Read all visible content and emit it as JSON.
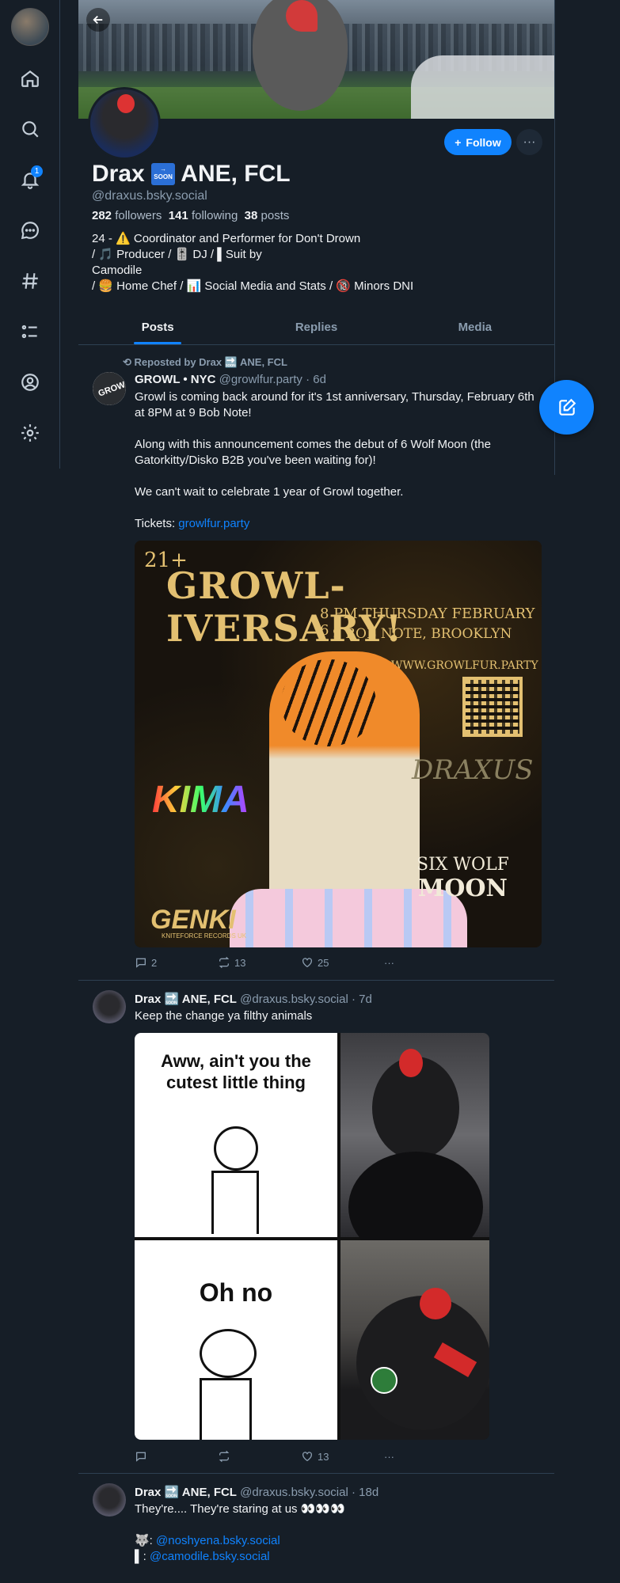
{
  "profile": {
    "display_name": "Drax",
    "name_suffix": "ANE, FCL",
    "soon_tag": "SOON",
    "handle": "@draxus.bsky.social",
    "follow_label": "Follow",
    "followers_count": "282",
    "followers_label": "followers",
    "following_count": "141",
    "following_label": "following",
    "posts_count": "38",
    "posts_label": "posts",
    "bio_line1": "24 - ⚠️ Coordinator and Performer for Don't Drown",
    "bio_line2": " / 🎵 Producer / 🎚️ DJ / ▌Suit by",
    "bio_line3": "Camodile",
    "bio_line4": " / 🍔 Home Chef / 📊 Social Media and Stats / 🔞 Minors DNI"
  },
  "nav": {
    "notification_badge": "1",
    "icons": [
      "home-icon",
      "search-icon",
      "bell-icon",
      "chat-icon",
      "hashtag-icon",
      "list-icon",
      "profile-icon",
      "gear-icon"
    ]
  },
  "tabs": [
    {
      "label": "Posts",
      "active": true
    },
    {
      "label": "Replies",
      "active": false
    },
    {
      "label": "Media",
      "active": false
    }
  ],
  "posts": [
    {
      "repost_label": "Reposted by Drax 🔜 ANE, FCL",
      "author": "GROWL • NYC",
      "handle": "@growlfur.party",
      "time": "· 6d",
      "text_p1": "Growl is coming back around for it's 1st anniversary, Thursday, February 6th at 8PM at 9 Bob Note!",
      "text_p2": "Along with this announcement comes the debut of 6 Wolf Moon (the Gatorkitty/Disko B2B you've been waiting for)!",
      "text_p3": "We can't wait to celebrate 1 year of Growl together.",
      "tickets_label": "Tickets:",
      "tickets_link": "growlfur.party",
      "poster": {
        "age": "21+",
        "title": "GROWL-IVERSARY!",
        "time": "8 PM THURSDAY FEBRUARY 6",
        "address": "9 BOB NOTE, BROOKLYN",
        "url": "WWW.GROWLFUR.PARTY",
        "artist1": "KIMA",
        "artist2": "DRAXUS",
        "artist3_line1": "SIX WOLF",
        "artist3_line2": "MOON",
        "artist4": "GENKI",
        "artist4_sub": "KNITEFORCE RECORDS UK"
      },
      "replies": "2",
      "reposts": "13",
      "likes": "25"
    },
    {
      "author": "Drax 🔜 ANE, FCL",
      "handle": "@draxus.bsky.social",
      "time": "· 7d",
      "text": "Keep the change ya filthy animals",
      "meme_top": "Aww, ain't you the cutest little thing",
      "meme_bottom": "Oh no",
      "replies": "",
      "reposts": "",
      "likes": "13"
    },
    {
      "author": "Drax 🔜 ANE, FCL",
      "handle": "@draxus.bsky.social",
      "time": "· 18d",
      "text": "They're.... They're staring at us 👀👀👀",
      "mention1_prefix": "🐺:",
      "mention1": "@noshyena.bsky.social",
      "mention2_prefix": "▌:",
      "mention2": "@camodile.bsky.social"
    }
  ],
  "colors": {
    "background": "#161e27",
    "accent": "#1083fe",
    "muted_text": "#8a9cae",
    "border": "#2e4052"
  }
}
